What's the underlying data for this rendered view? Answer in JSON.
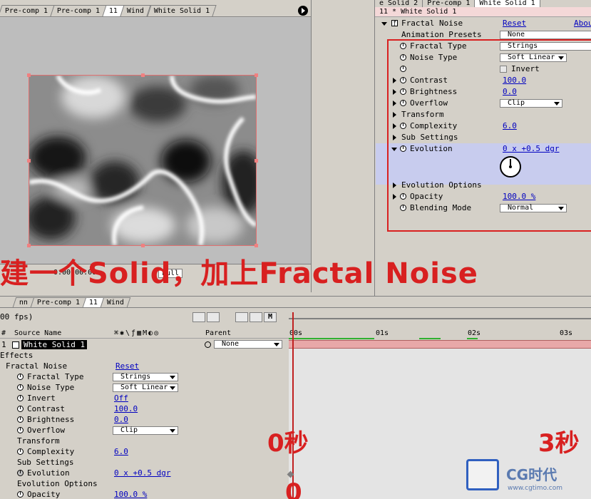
{
  "comp": {
    "tabs": [
      "Pre-comp 1",
      "Pre-comp 1",
      "11",
      "Wind",
      "White Solid 1"
    ],
    "footer_zoom": "0:00:00:00",
    "footer_quality": "Full"
  },
  "effect_controls": {
    "tabs": [
      "e Solid 2",
      "Pre-comp 1",
      "White Solid 1"
    ],
    "title": "11 * White Solid 1",
    "effect_name": "Fractal Noise",
    "reset_label": "Reset",
    "about_label": "About",
    "presets_label": "Animation Presets",
    "presets_value": "None",
    "rows": {
      "fractal_type": {
        "label": "Fractal Type",
        "value": "Strings"
      },
      "noise_type": {
        "label": "Noise Type",
        "value": "Soft Linear"
      },
      "invert": {
        "label": "Invert"
      },
      "contrast": {
        "label": "Contrast",
        "value": "100.0"
      },
      "brightness": {
        "label": "Brightness",
        "value": "0.0"
      },
      "overflow": {
        "label": "Overflow",
        "value": "Clip"
      },
      "transform": {
        "label": "Transform"
      },
      "complexity": {
        "label": "Complexity",
        "value": "6.0"
      },
      "sub_settings": {
        "label": "Sub Settings"
      },
      "evolution": {
        "label": "Evolution",
        "value": "0 x +0.5 dgr"
      },
      "evolution_options": {
        "label": "Evolution Options"
      },
      "opacity": {
        "label": "Opacity",
        "value": "100.0 %"
      },
      "blending_mode": {
        "label": "Blending Mode",
        "value": "Normal"
      }
    }
  },
  "caption": "建一个Solid，加上Fractal Noise",
  "timeline": {
    "tabs": [
      "nn",
      "Pre-comp 1",
      "11",
      "Wind"
    ],
    "fps": "00 fps)",
    "ruler": [
      "00s",
      "01s",
      "02s",
      "03s"
    ],
    "header": {
      "num": "#",
      "source": "Source Name",
      "parent": "Parent"
    },
    "layer": {
      "num": "1",
      "name": "White Solid 1",
      "parent": "None"
    },
    "effects_label": "Effects",
    "effect_name": "Fractal Noise",
    "reset_label": "Reset",
    "rows": {
      "fractal_type": {
        "label": "Fractal Type",
        "value": "Strings"
      },
      "noise_type": {
        "label": "Noise Type",
        "value": "Soft Linear"
      },
      "invert": {
        "label": "Invert",
        "value": "Off"
      },
      "contrast": {
        "label": "Contrast",
        "value": "100.0"
      },
      "brightness": {
        "label": "Brightness",
        "value": "0.0"
      },
      "overflow": {
        "label": "Overflow",
        "value": "Clip"
      },
      "transform": {
        "label": "Transform"
      },
      "complexity": {
        "label": "Complexity",
        "value": "6.0"
      },
      "sub_settings": {
        "label": "Sub Settings"
      },
      "evolution": {
        "label": "Evolution",
        "value": "0 x +0.5 dgr"
      },
      "evolution_options": {
        "label": "Evolution Options"
      },
      "opacity": {
        "label": "Opacity",
        "value": "100.0 %"
      }
    },
    "annotation_0": "0秒",
    "annotation_3": "3秒",
    "annotation_bottom_0": "0"
  },
  "watermark": {
    "logo": "CG时代",
    "url": "www.cgtimo.com"
  },
  "colors": {
    "annotation_red": "#d82020",
    "link_blue": "#0000c0",
    "evolution_highlight": "#c8ccee"
  }
}
